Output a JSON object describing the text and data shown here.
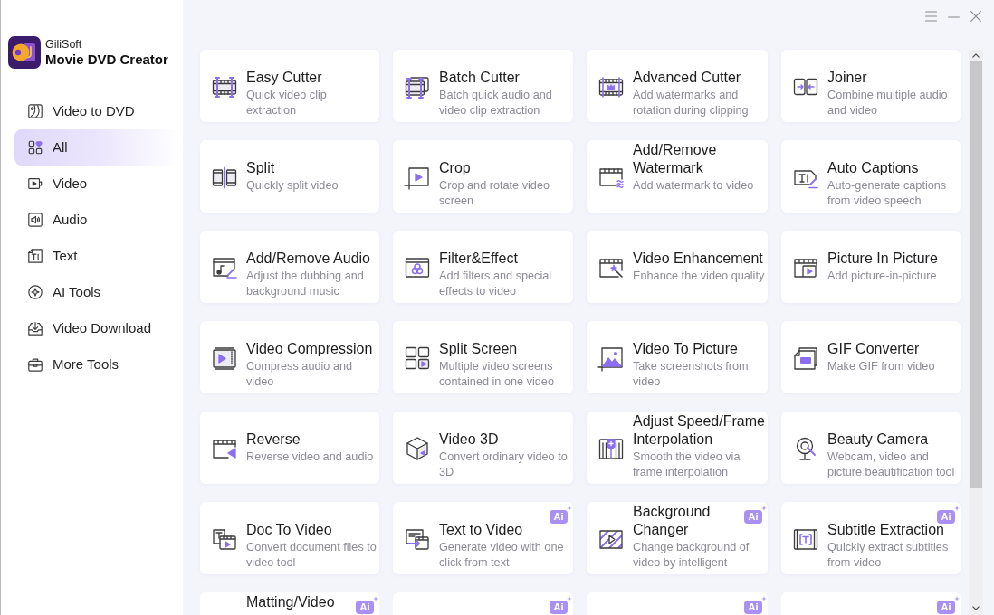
{
  "app": {
    "brand": "GiliSoft",
    "product": "Movie DVD Creator"
  },
  "sidebar": {
    "items": [
      {
        "label": "Video to DVD",
        "selected": false
      },
      {
        "label": "All",
        "selected": true
      },
      {
        "label": "Video",
        "selected": false
      },
      {
        "label": "Audio",
        "selected": false
      },
      {
        "label": "Text",
        "selected": false
      },
      {
        "label": "AI Tools",
        "selected": false
      },
      {
        "label": "Video Download",
        "selected": false
      },
      {
        "label": "More Tools",
        "selected": false
      }
    ]
  },
  "tools": [
    {
      "title": "Easy Cutter",
      "description": "Quick video clip extraction"
    },
    {
      "title": "Batch Cutter",
      "description": "Batch quick audio and video clip extraction"
    },
    {
      "title": "Advanced Cutter",
      "description": "Add watermarks and rotation during clipping"
    },
    {
      "title": "Joiner",
      "description": "Combine multiple audio and video"
    },
    {
      "title": "Split",
      "description": "Quickly split video"
    },
    {
      "title": "Crop",
      "description": "Crop and rotate video screen"
    },
    {
      "title": "Add/Remove Watermark",
      "description": "Add watermark to video"
    },
    {
      "title": "Auto Captions",
      "description": "Auto-generate captions from video speech"
    },
    {
      "title": "Add/Remove Audio",
      "description": "Adjust the dubbing and background music"
    },
    {
      "title": "Filter&Effect",
      "description": "Add filters and special effects to video"
    },
    {
      "title": "Video Enhancement",
      "description": "Enhance the video quality"
    },
    {
      "title": "Picture In Picture",
      "description": "Add picture-in-picture"
    },
    {
      "title": "Video Compression",
      "description": "Compress audio and video"
    },
    {
      "title": "Split Screen",
      "description": "Multiple video screens contained in one video"
    },
    {
      "title": "Video To Picture",
      "description": "Take screenshots from video"
    },
    {
      "title": "GIF Converter",
      "description": "Make GIF from video"
    },
    {
      "title": "Reverse",
      "description": "Reverse video and audio"
    },
    {
      "title": "Video 3D",
      "description": "Convert ordinary video to 3D"
    },
    {
      "title": "Adjust Speed/Frame Interpolation",
      "description": "Smooth the video via frame interpolation"
    },
    {
      "title": "Beauty Camera",
      "description": "Webcam, video and picture beautification tool"
    },
    {
      "title": "Doc To Video",
      "description": "Convert document files to video tool"
    },
    {
      "title": "Text to Video",
      "description": "Generate video with one click from text",
      "badge": "Ai"
    },
    {
      "title": "Background Changer",
      "description": "Change background of video by intelligent",
      "badge": "Ai"
    },
    {
      "title": "Subtitle Extraction",
      "description": "Quickly extract subtitles from video",
      "badge": "Ai"
    }
  ],
  "partial_row": [
    {
      "title": "Matting/Video",
      "badge": "Ai"
    },
    {
      "badge": "Ai"
    },
    {
      "badge": "Ai"
    },
    {
      "badge": "Ai"
    }
  ]
}
